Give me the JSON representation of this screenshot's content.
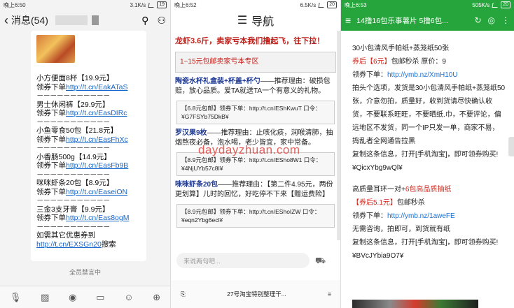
{
  "phone1": {
    "status": {
      "time": "晚上6:50",
      "net": "3.1K/s"
    },
    "title": "消息(54)",
    "items": [
      {
        "name": "小方便面8杯【19.9元】",
        "link_prefix": "领券下单",
        "link": "http://t.cn/EakATaS"
      },
      {
        "name": "男士休闲裤【29.9元】",
        "link_prefix": "领券下单",
        "link": "http://t.cn/EasDIRc"
      },
      {
        "name": "小鱼零食50包【21.8元】",
        "link_prefix": "领券下单",
        "link": "http://t.cn/EasFhXc"
      },
      {
        "name": "小香肠500g【14.9元】",
        "link_prefix": "领券下单",
        "link": "http://t.cn/EasFb9B"
      },
      {
        "name": "咪咪虾条20包【8.9元】",
        "link_prefix": "领券下单",
        "link": "http://t.cn/EaseiON"
      },
      {
        "name": "三金3支牙膏【9.9元】",
        "link_prefix": "领券下单",
        "link": "http://t.cn/Eas8ogM"
      }
    ],
    "separator": "－－－－－－－－－－－",
    "footer_text": "如需其它优惠券到",
    "footer_link": "http://t.cn/EXSGn20",
    "footer_suffix": "搜索",
    "mute_notice": "全员禁言中"
  },
  "phone2": {
    "status": {
      "time": "晚上6:52",
      "net": "6.5K/s"
    },
    "nav_title": "导航",
    "banner": "龙虾3.6斤，卖家亏本我们撸起飞，往下拉！",
    "zone": "1~15元包邮卖家亏本专区",
    "products": [
      {
        "name": "陶瓷水杯礼盒装+杯盖+杯勺",
        "desc": "——推荐理由：破损包赔，放心品质。爱TA就送TA一个有意义的礼物。",
        "code1": "【6.8元包邮】领券下单：http://t.cn/EShKwuT 口令：",
        "code2": "¥G7FSYb75DkB¥"
      },
      {
        "name": "罗汉果9枚",
        "desc": "——推荐理由：止咳化痰，润喉清肺，抽烟熬夜必备，泡水喝，老少皆宜，家中常备。",
        "code1": "【8.9元包邮】领券下单：http://t.cn/ESho8W1 口令：",
        "code2": "¥4NjUYb57c8I¥"
      },
      {
        "name": "咪咪虾条20包",
        "desc": "——推荐理由：【第二件4.95元，两份更划算】儿时的回忆，好吃停不下来【赠运费险】",
        "code1": "【8.9元包邮】领券下单：http://t.cn/EShoIZW 口令：",
        "code2": "¥eqn2Ybg6ecl¥"
      }
    ],
    "comment_placeholder": "来说两句吧...",
    "bottom_label": "27号淘宝特别整理干..."
  },
  "watermark": "daydayzhuan.com",
  "phone3": {
    "status": {
      "time": "晚上6:53",
      "net": "505K/s"
    },
    "title": "14撸16包乐事薯片 5撸6包...",
    "blocks": [
      {
        "head": "30小包清风手帕纸+蒸笼纸50张",
        "price_red": "券后【6元】",
        "price_rest": "包邮秒杀 原价：9",
        "link_prefix": "领券下单：",
        "link": "http://ymb.nz/XmH10U",
        "body": "拍头个选项，发货是30小包清风手帕纸+蒸笼纸50张，介意勿拍，质量好，收到货请尽快确认收货，不要联系旺旺，不要晒纸.巾，不要评论，偏远地区不发货，同一个IP只发一单，商家不易，捣乱者全网通告拉黑",
        "copy": "复制这条信息，打开[手机淘宝]，即可领券购买!",
        "code": "¥QicxYbg9wQl¥"
      },
      {
        "head_black": "高质量耳环一对+",
        "head_red": "6包高品质抽纸",
        "price_red": "【券后5.1元】",
        "price_rest": "包邮秒杀",
        "link_prefix": "领券下单：",
        "link": "http://ymb.nz/1aweFE",
        "body": "无需咨询，拍即可，到货就有纸",
        "copy": "复制这条信息，打开[手机淘宝]，即可领券购买!",
        "code": "¥BVcJYbia9O7¥"
      }
    ]
  }
}
